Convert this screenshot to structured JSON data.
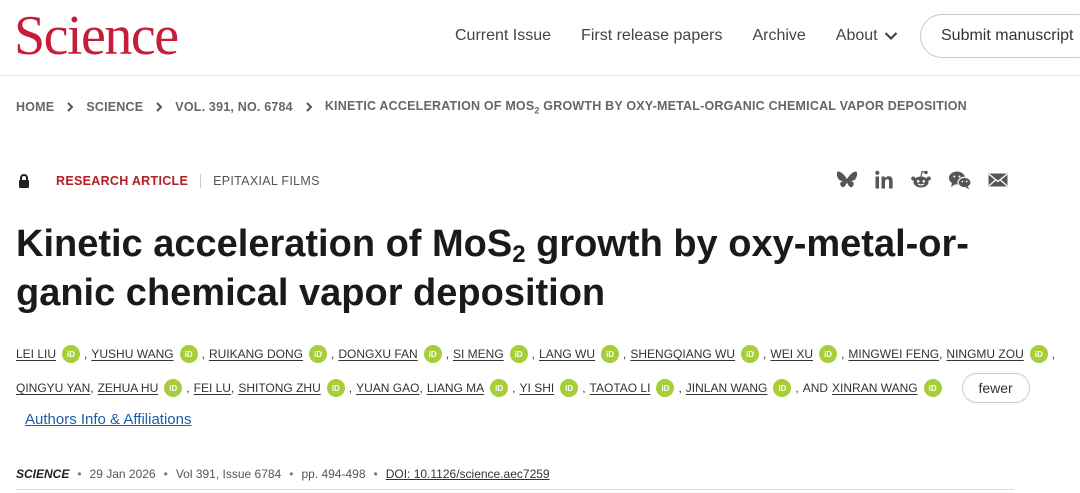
{
  "brand": {
    "logo": "Science",
    "color": "#c41e3a"
  },
  "nav": {
    "items": [
      {
        "label": "Current Issue"
      },
      {
        "label": "First release papers"
      },
      {
        "label": "Archive"
      },
      {
        "label": "About"
      }
    ],
    "submit_label": "Submit manuscript"
  },
  "breadcrumb": {
    "home": "HOME",
    "science": "SCIENCE",
    "issue": "VOL. 391, NO. 6784",
    "current_pre": "KINETIC ACCELERATION OF MOS",
    "current_sub": "2",
    "current_post": " GROWTH BY OXY-METAL-ORGANIC CHEMICAL VAPOR DEPOSITION"
  },
  "article_type": {
    "type": "RESEARCH ARTICLE",
    "subject": "EPITAXIAL FILMS"
  },
  "share_icons": [
    "bluesky-icon",
    "linkedin-icon",
    "reddit-icon",
    "wechat-icon",
    "email-icon"
  ],
  "title": {
    "line1_pre": "Kinetic acceleration of MoS",
    "line1_sub": "2",
    "line1_post": " growth by oxy-metal-or-",
    "line2": "ganic chemical vapor deposition"
  },
  "authors_line1": [
    {
      "name": "LEI LIU",
      "orcid": true
    },
    {
      "name": "YUSHU WANG",
      "orcid": true
    },
    {
      "name": "RUIKANG DONG",
      "orcid": true
    },
    {
      "name": "DONGXU FAN",
      "orcid": true
    },
    {
      "name": "SI MENG",
      "orcid": true
    },
    {
      "name": "LANG WU",
      "orcid": true
    },
    {
      "name": "SHENGQIANG WU",
      "orcid": true
    },
    {
      "name": "WEI XU",
      "orcid": true
    },
    {
      "name": "MINGWEI FENG",
      "orcid": false
    },
    {
      "name": "NINGMU ZOU",
      "orcid": true
    }
  ],
  "authors_line2": [
    {
      "name": "QINGYU YAN",
      "orcid": false
    },
    {
      "name": "ZEHUA HU",
      "orcid": true
    },
    {
      "name": "FEI LU",
      "orcid": false
    },
    {
      "name": "SHITONG ZHU",
      "orcid": true
    },
    {
      "name": "YUAN GAO",
      "orcid": false
    },
    {
      "name": "LIANG MA",
      "orcid": true
    },
    {
      "name": "YI SHI",
      "orcid": true
    },
    {
      "name": "TAOTAO LI",
      "orcid": true
    },
    {
      "name": "JINLAN WANG",
      "orcid": true
    }
  ],
  "last_author_prefix": "AND",
  "last_author": {
    "name": "XINRAN WANG",
    "orcid": true
  },
  "orcid_label": "iD",
  "fewer_label": "fewer",
  "affiliations_label": "Authors Info & Affiliations",
  "meta": {
    "journal": "SCIENCE",
    "date": "29 Jan 2026",
    "volume": "Vol 391, Issue 6784",
    "pages": "pp. 494-498",
    "doi": "DOI: 10.1126/science.aec7259"
  }
}
